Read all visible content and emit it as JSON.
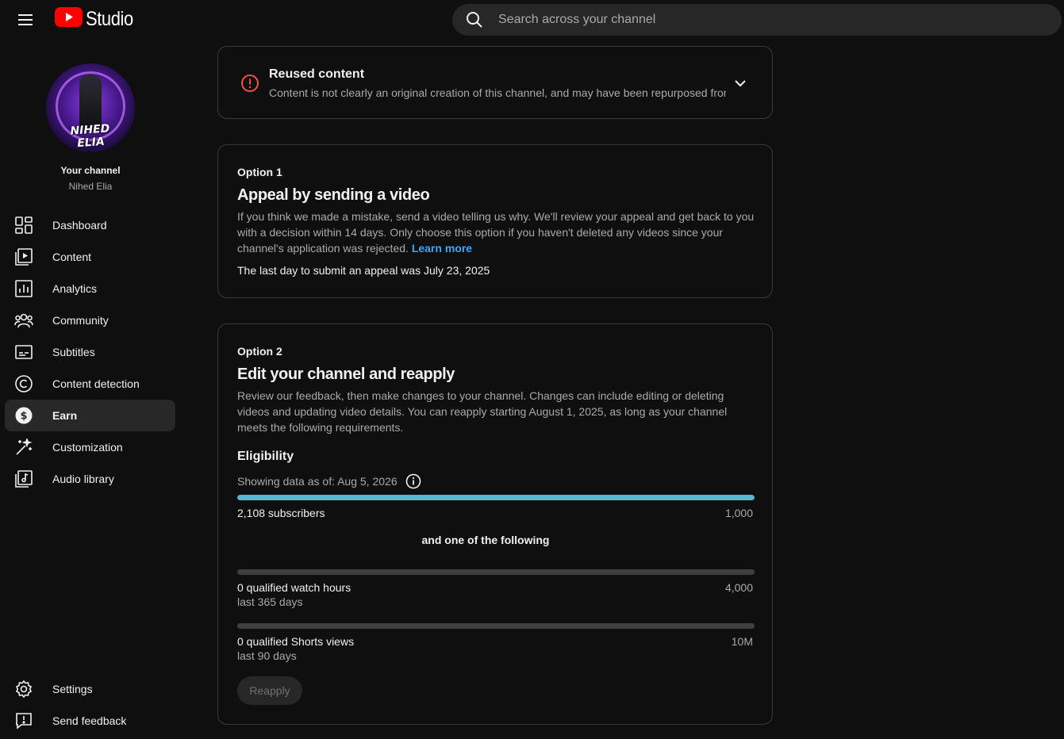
{
  "header": {
    "app_name": "Studio",
    "search_placeholder": "Search across your channel"
  },
  "channel": {
    "avatar_text": "NIHED ELIA",
    "title": "Your channel",
    "name": "Nihed Elia"
  },
  "sidebar": {
    "items": [
      {
        "label": "Dashboard",
        "icon": "dashboard-icon"
      },
      {
        "label": "Content",
        "icon": "content-icon"
      },
      {
        "label": "Analytics",
        "icon": "analytics-icon"
      },
      {
        "label": "Community",
        "icon": "community-icon"
      },
      {
        "label": "Subtitles",
        "icon": "subtitles-icon"
      },
      {
        "label": "Content detection",
        "icon": "copyright-icon"
      },
      {
        "label": "Earn",
        "icon": "dollar-icon",
        "active": true
      },
      {
        "label": "Customization",
        "icon": "magic-wand-icon"
      },
      {
        "label": "Audio library",
        "icon": "audio-library-icon"
      }
    ],
    "bottom_items": [
      {
        "label": "Settings",
        "icon": "gear-icon"
      },
      {
        "label": "Send feedback",
        "icon": "feedback-icon"
      }
    ]
  },
  "reused": {
    "title": "Reused content",
    "description": "Content is not clearly an original creation of this channel, and may have been repurposed from"
  },
  "option1": {
    "label": "Option 1",
    "title": "Appeal by sending a video",
    "description": "If you think we made a mistake, send a video telling us why. We'll review your appeal and get back to you with a decision within 14 days. Only choose this option if you haven't deleted any videos since your channel's application was rejected.",
    "link": "Learn more",
    "deadline": "The last day to submit an appeal was July 23, 2025"
  },
  "option2": {
    "label": "Option 2",
    "title": "Edit your channel and reapply",
    "description": "Review our feedback, then make changes to your channel. Changes can include editing or deleting videos and updating video details. You can reapply starting August 1, 2025, as long as your channel meets the following requirements.",
    "eligibility_title": "Eligibility",
    "data_as_of": "Showing data as of: Aug 5, 2026",
    "or_label": "and one of the following",
    "metrics": [
      {
        "label": "2,108 subscribers",
        "target": "1,000",
        "sub": "",
        "progress": 1.0
      },
      {
        "label": "0 qualified watch hours",
        "target": "4,000",
        "sub": "last 365 days",
        "progress": 0
      },
      {
        "label": "0 qualified Shorts views",
        "target": "10M",
        "sub": "last 90 days",
        "progress": 0
      }
    ],
    "button": "Reapply"
  },
  "colors": {
    "accent_bar": "#51b8d6",
    "alert_red": "#ff4e45",
    "link": "#3ea6ff",
    "youtube_red": "#ff0000"
  }
}
